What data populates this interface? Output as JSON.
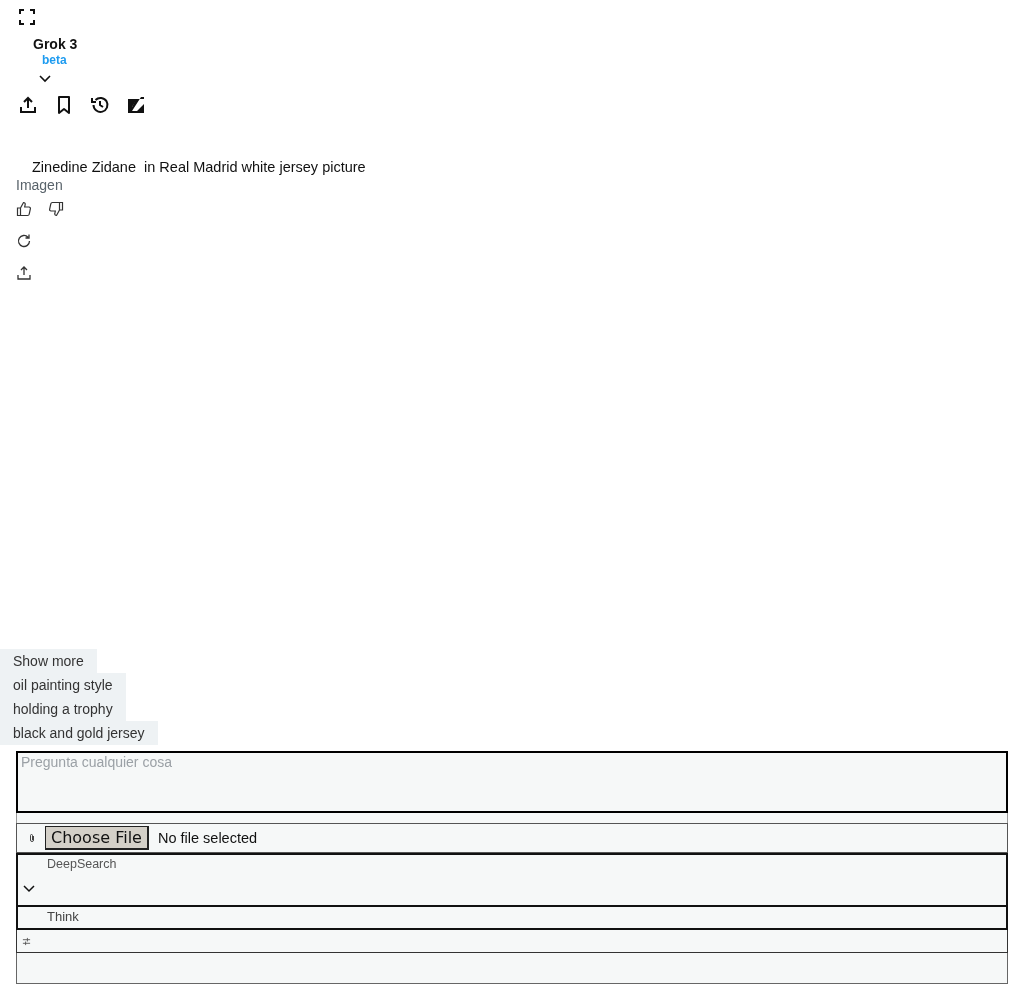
{
  "header": {
    "title": "Grok 3",
    "badge": "beta"
  },
  "message": {
    "prompt": "Zinedine Zidane  in Real Madrid white jersey picture",
    "label": "Imagen"
  },
  "suggestions": [
    "Show more",
    "oil painting style",
    "holding a trophy",
    "black and gold jersey"
  ],
  "composer": {
    "placeholder": "Pregunta cualquier cosa",
    "file_button": "Choose File",
    "file_status": "No file selected",
    "options": [
      {
        "label": "DeepSearch"
      },
      {
        "label": "Think"
      }
    ]
  }
}
